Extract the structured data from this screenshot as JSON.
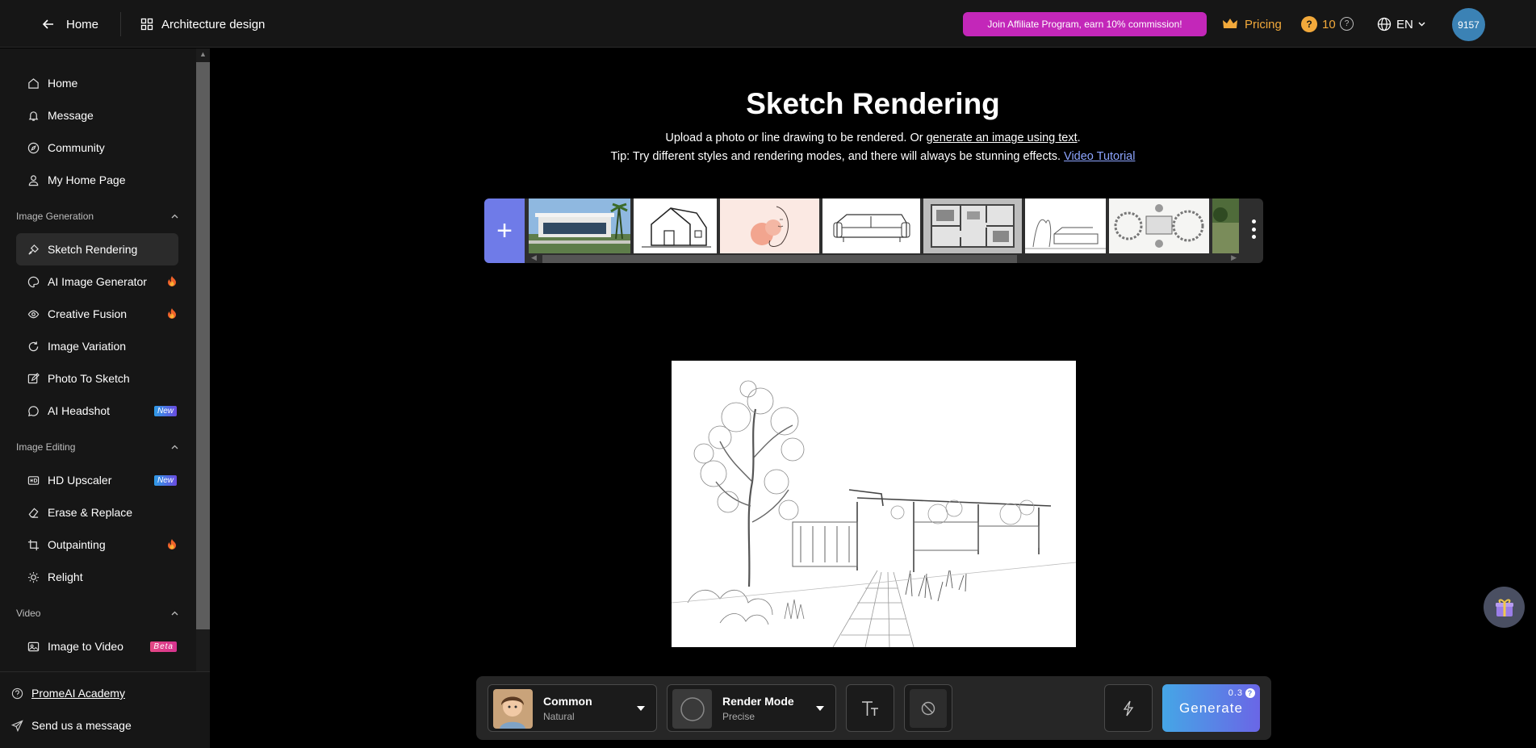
{
  "header": {
    "home_label": "Home",
    "workspace_label": "Architecture design",
    "affiliate_label": "Join Affiliate Program, earn 10% commission!",
    "pricing_label": "Pricing",
    "credits": "10",
    "lang": "EN",
    "avatar_label": "9157"
  },
  "sidebar": {
    "main_items": [
      {
        "label": "Home",
        "icon": "home-icon"
      },
      {
        "label": "Message",
        "icon": "bell-icon"
      },
      {
        "label": "Community",
        "icon": "compass-icon"
      },
      {
        "label": "My Home Page",
        "icon": "user-icon"
      }
    ],
    "section_image_generation": "Image Generation",
    "image_generation": [
      {
        "label": "Sketch Rendering",
        "icon": "brush-icon"
      },
      {
        "label": "AI Image Generator",
        "icon": "palette-icon"
      },
      {
        "label": "Creative Fusion",
        "icon": "fusion-icon"
      },
      {
        "label": "Image Variation",
        "icon": "refresh-icon"
      },
      {
        "label": "Photo To Sketch",
        "icon": "edit-icon"
      },
      {
        "label": "AI Headshot",
        "icon": "chat-icon"
      }
    ],
    "section_image_editing": "Image Editing",
    "image_editing": [
      {
        "label": "HD Upscaler",
        "icon": "hd-icon"
      },
      {
        "label": "Erase & Replace",
        "icon": "eraser-icon"
      },
      {
        "label": "Outpainting",
        "icon": "crop-icon"
      },
      {
        "label": "Relight",
        "icon": "bulb-icon"
      }
    ],
    "section_video": "Video",
    "video": [
      {
        "label": "Image to Video",
        "icon": "image-icon"
      }
    ],
    "badge_new": "New",
    "badge_beta": "Beta",
    "footer": {
      "academy": "PromeAI Academy",
      "message": "Send us a message"
    }
  },
  "main": {
    "title": "Sketch Rendering",
    "subtitle_prefix": "Upload a photo or line drawing to be rendered. Or ",
    "subtitle_link": "generate an image using text",
    "subtitle_suffix": ".",
    "tip": "Tip: Try different styles and rendering modes, and there will always be stunning effects.",
    "video_tutorial": "Video Tutorial",
    "add_symbol": "+"
  },
  "bottom": {
    "model_name": "Common",
    "model_sub": "Natural",
    "mode_name": "Render Mode",
    "mode_sub": "Precise",
    "generate_label": "Generate",
    "generate_cost": "0.3"
  }
}
